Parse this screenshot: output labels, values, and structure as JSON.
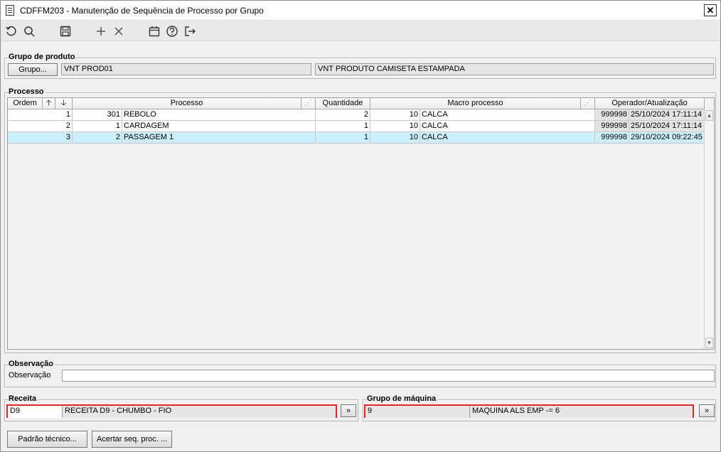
{
  "window": {
    "title": "CDFFM203 - Manutenção de Sequência de Processo por Grupo",
    "close_label": "✕"
  },
  "toolbar": {
    "icons": [
      "refresh-icon",
      "search-icon",
      "save-icon",
      "add-icon",
      "delete-icon",
      "calendar-icon",
      "help-icon",
      "exit-icon"
    ]
  },
  "grupo_produto": {
    "legend": "Grupo de produto",
    "button_label": "Grupo...",
    "code": "VNT PROD01",
    "description": "VNT PRODUTO CAMISETA ESTAMPADA"
  },
  "processo": {
    "legend": "Processo",
    "headers": {
      "ordem": "Ordem",
      "processo": "Processo",
      "quantidade": "Quantidade",
      "macro_processo": "Macro processo",
      "operador": "Operador/Atualização"
    },
    "rows": [
      {
        "ordem": "1",
        "proc_code": "301",
        "proc_name": "REBOLO",
        "quantidade": "2",
        "macro_code": "10",
        "macro_name": "CALCA",
        "operador": "999998",
        "atualizacao": "25/10/2024 17:11:14"
      },
      {
        "ordem": "2",
        "proc_code": "1",
        "proc_name": "CARDAGEM",
        "quantidade": "1",
        "macro_code": "10",
        "macro_name": "CALCA",
        "operador": "999998",
        "atualizacao": "25/10/2024 17:11:14"
      },
      {
        "ordem": "3",
        "proc_code": "2",
        "proc_name": "PASSAGEM 1",
        "quantidade": "1",
        "macro_code": "10",
        "macro_name": "CALCA",
        "operador": "999998",
        "atualizacao": "29/10/2024 09:22:45"
      }
    ]
  },
  "observacao": {
    "legend": "Observação",
    "label": "Observação",
    "value": ""
  },
  "receita": {
    "legend": "Receita",
    "code": "D9",
    "description": "RECEITA D9 - CHUMBO - FIO",
    "button_label": "»"
  },
  "grupo_maquina": {
    "legend": "Grupo de máquina",
    "code": "9",
    "description": "MAQUINA ALS EMP  -= 6",
    "button_label": "»"
  },
  "footer": {
    "padrao_tecnico": "Padrão técnico...",
    "acertar_seq": "Acertar seq. proc. ..."
  },
  "colors": {
    "selected_row": "#ccf0ff",
    "highlight_border": "#e2272b"
  }
}
